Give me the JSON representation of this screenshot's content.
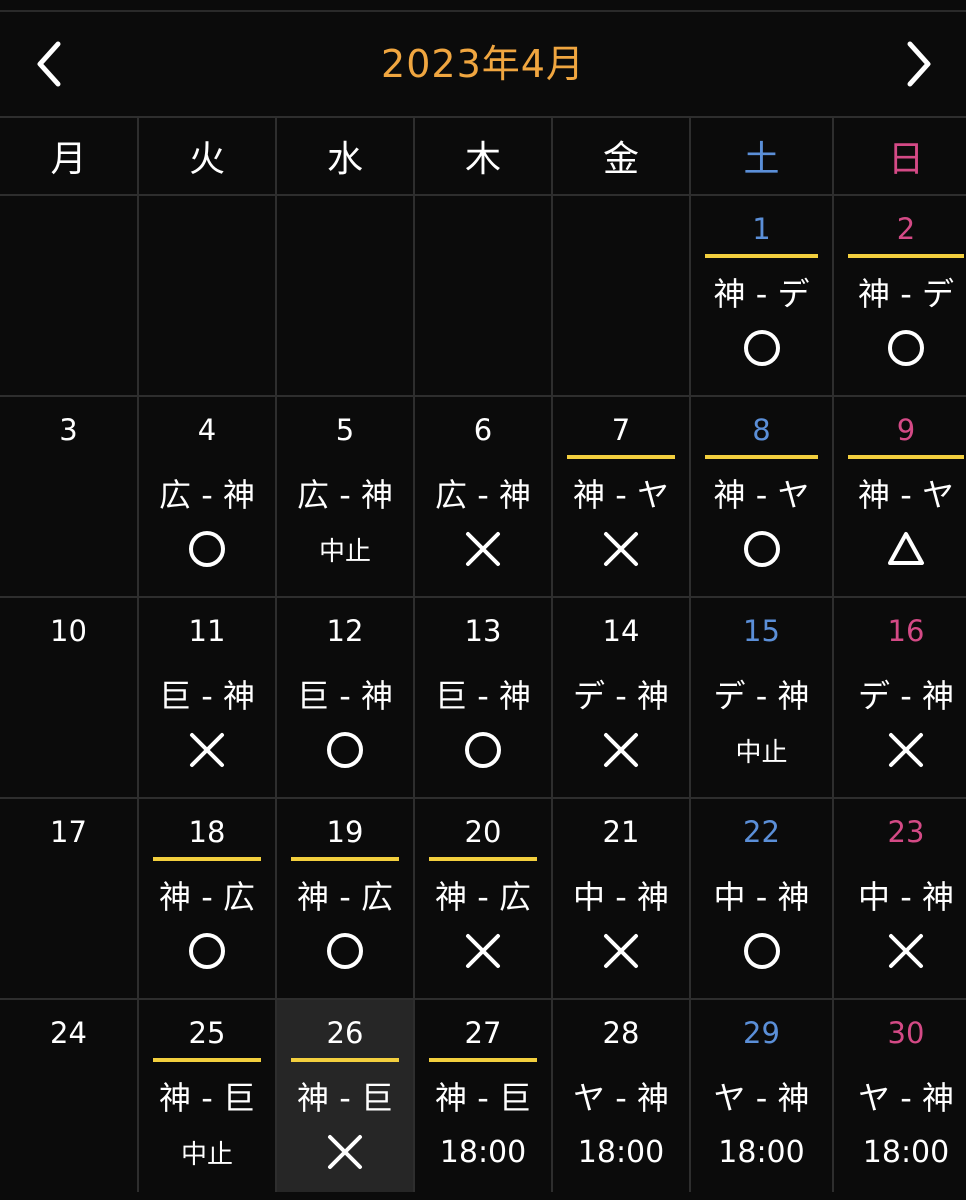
{
  "header": {
    "title": "2023年4月",
    "prev_icon": "chevron-left-icon",
    "next_icon": "chevron-right-icon"
  },
  "colors": {
    "title": "#f0a640",
    "saturday": "#5b8fd8",
    "sunday": "#d44a86",
    "home_bar": "#f3cf3e",
    "selected_bg": "#262626"
  },
  "weekdays": [
    "月",
    "火",
    "水",
    "木",
    "金",
    "土",
    "日"
  ],
  "weeks": [
    [
      {
        "day": ""
      },
      {
        "day": ""
      },
      {
        "day": ""
      },
      {
        "day": ""
      },
      {
        "day": ""
      },
      {
        "day": "1",
        "home": true,
        "match": "神 - デ",
        "result": "○"
      },
      {
        "day": "2",
        "home": true,
        "match": "神 - デ",
        "result": "○"
      }
    ],
    [
      {
        "day": "3",
        "match": "",
        "result": ""
      },
      {
        "day": "4",
        "match": "広 - 神",
        "result": "○"
      },
      {
        "day": "5",
        "match": "広 - 神",
        "result": "中止"
      },
      {
        "day": "6",
        "match": "広 - 神",
        "result": "×"
      },
      {
        "day": "7",
        "home": true,
        "match": "神 - ヤ",
        "result": "×"
      },
      {
        "day": "8",
        "home": true,
        "match": "神 - ヤ",
        "result": "○"
      },
      {
        "day": "9",
        "home": true,
        "match": "神 - ヤ",
        "result": "△"
      }
    ],
    [
      {
        "day": "10",
        "match": "",
        "result": ""
      },
      {
        "day": "11",
        "match": "巨 - 神",
        "result": "×"
      },
      {
        "day": "12",
        "match": "巨 - 神",
        "result": "○"
      },
      {
        "day": "13",
        "match": "巨 - 神",
        "result": "○"
      },
      {
        "day": "14",
        "match": "デ - 神",
        "result": "×"
      },
      {
        "day": "15",
        "match": "デ - 神",
        "result": "中止"
      },
      {
        "day": "16",
        "match": "デ - 神",
        "result": "×"
      }
    ],
    [
      {
        "day": "17",
        "match": "",
        "result": ""
      },
      {
        "day": "18",
        "home": true,
        "match": "神 - 広",
        "result": "○"
      },
      {
        "day": "19",
        "home": true,
        "match": "神 - 広",
        "result": "○"
      },
      {
        "day": "20",
        "home": true,
        "match": "神 - 広",
        "result": "×"
      },
      {
        "day": "21",
        "match": "中 - 神",
        "result": "×"
      },
      {
        "day": "22",
        "match": "中 - 神",
        "result": "○"
      },
      {
        "day": "23",
        "match": "中 - 神",
        "result": "×"
      }
    ],
    [
      {
        "day": "24",
        "match": "",
        "result": ""
      },
      {
        "day": "25",
        "home": true,
        "match": "神 - 巨",
        "result": "中止"
      },
      {
        "day": "26",
        "home": true,
        "selected": true,
        "match": "神 - 巨",
        "result": "×"
      },
      {
        "day": "27",
        "home": true,
        "match": "神 - 巨",
        "result": "18:00"
      },
      {
        "day": "28",
        "match": "ヤ - 神",
        "result": "18:00"
      },
      {
        "day": "29",
        "match": "ヤ - 神",
        "result": "18:00"
      },
      {
        "day": "30",
        "match": "ヤ - 神",
        "result": "18:00"
      }
    ]
  ]
}
